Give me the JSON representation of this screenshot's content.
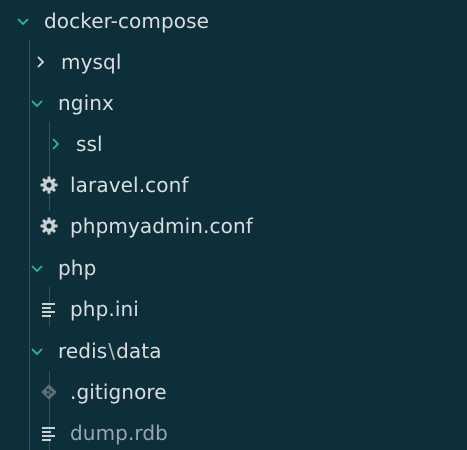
{
  "tree": {
    "root": {
      "label": "docker-compose",
      "expanded": true
    },
    "mysql": {
      "label": "mysql",
      "expanded": false
    },
    "nginx": {
      "label": "nginx",
      "expanded": true
    },
    "ssl": {
      "label": "ssl",
      "expanded": false
    },
    "laravel_conf": {
      "label": "laravel.conf",
      "icon": "gear-icon"
    },
    "phpmyadmin_conf": {
      "label": "phpmyadmin.conf",
      "icon": "gear-icon"
    },
    "php": {
      "label": "php",
      "expanded": true
    },
    "php_ini": {
      "label": "php.ini",
      "icon": "lines-icon"
    },
    "redis_data": {
      "label_left": "redis",
      "separator": "\\",
      "label_right": "data",
      "expanded": true
    },
    "gitignore": {
      "label": ".gitignore",
      "icon": "git-diamond-icon"
    },
    "dump_rdb": {
      "label": "dump.rdb",
      "icon": "lines-icon"
    }
  },
  "colors": {
    "background": "#0d2f3a",
    "text": "#d9dde0",
    "muted_text": "#9aa8ad",
    "chevron_accent": "#2fb79a",
    "icon": "#c9d1d4",
    "guide": "#2f5560"
  }
}
